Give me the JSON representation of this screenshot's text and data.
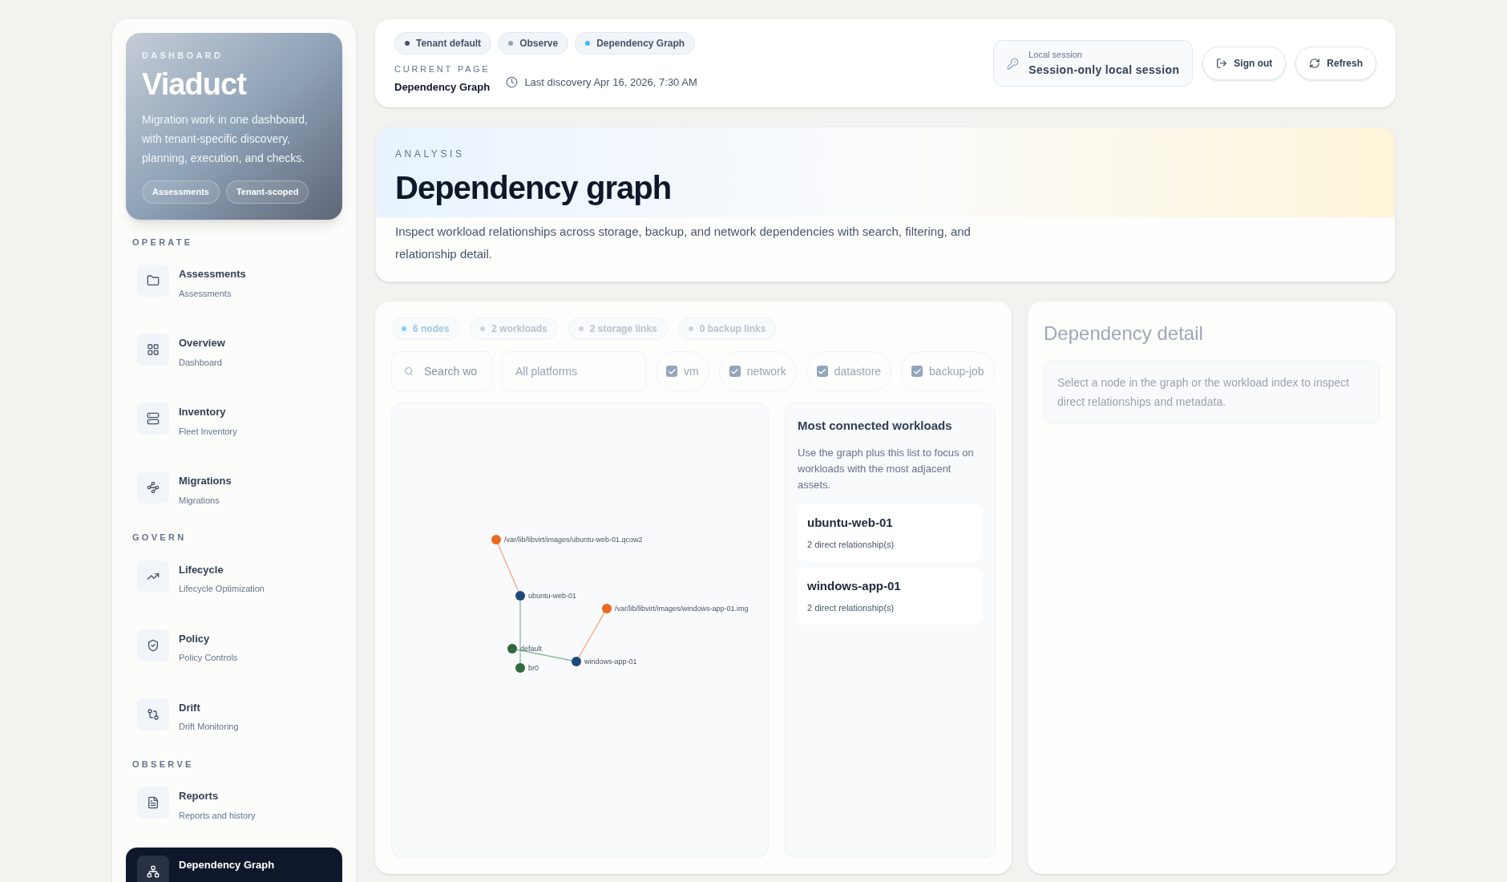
{
  "sidebar": {
    "hero": {
      "eyebrow": "DASHBOARD",
      "title": "Viaduct",
      "description": "Migration work in one dashboard, with tenant-specific discovery, planning, execution, and checks.",
      "tags": [
        "Assessments",
        "Tenant-scoped"
      ]
    },
    "sections": [
      {
        "label": "OPERATE",
        "items": [
          {
            "title": "Assessments",
            "subtitle": "Assessments",
            "selected": false
          },
          {
            "title": "Overview",
            "subtitle": "Dashboard",
            "selected": false
          },
          {
            "title": "Inventory",
            "subtitle": "Fleet Inventory",
            "selected": false
          },
          {
            "title": "Migrations",
            "subtitle": "Migrations",
            "selected": false
          }
        ]
      },
      {
        "label": "GOVERN",
        "items": [
          {
            "title": "Lifecycle",
            "subtitle": "Lifecycle Optimization",
            "selected": false
          },
          {
            "title": "Policy",
            "subtitle": "Policy Controls",
            "selected": false
          },
          {
            "title": "Drift",
            "subtitle": "Drift Monitoring",
            "selected": false
          }
        ]
      },
      {
        "label": "OBSERVE",
        "items": [
          {
            "title": "Reports",
            "subtitle": "Reports and history",
            "selected": false
          },
          {
            "title": "Dependency Graph",
            "selected": true
          }
        ]
      }
    ]
  },
  "header": {
    "breadcrumbs": [
      {
        "label": "Tenant default",
        "color": "#475569"
      },
      {
        "label": "Observe",
        "color": "#94a3b8"
      },
      {
        "label": "Dependency Graph",
        "color": "#38bdf8"
      }
    ],
    "current_page_label": "CURRENT PAGE",
    "current_page": "Dependency Graph",
    "last_discovery": "Last discovery Apr 16, 2026, 7:30 AM",
    "session": {
      "label": "Local session",
      "value": "Session-only local session"
    },
    "buttons": [
      {
        "kind": "signout",
        "label": "Sign out"
      },
      {
        "kind": "refresh",
        "label": "Refresh"
      }
    ]
  },
  "banner": {
    "eyebrow": "ANALYSIS",
    "title": "Dependency graph",
    "description": "Inspect workload relationships across storage, backup, and network dependencies with search, filtering, and relationship detail."
  },
  "stats": [
    {
      "label": "6 nodes",
      "color": "#7dd3fc"
    },
    {
      "label": "2 workloads",
      "color": "#cbd5e1"
    },
    {
      "label": "2 storage links",
      "color": "#cbd5e1"
    },
    {
      "label": "0 backup links",
      "color": "#cbd5e1"
    }
  ],
  "filters": {
    "search": {
      "placeholder": "Search wo"
    },
    "platform": "All platforms",
    "types": [
      {
        "label": "vm",
        "checked": true
      },
      {
        "label": "network",
        "checked": true
      },
      {
        "label": "datastore",
        "checked": true
      },
      {
        "label": "backup-job",
        "checked": true
      }
    ]
  },
  "graph": {
    "nodes": [
      {
        "label": "/var/lib/libvirt/images/ubuntu-web-01.qcow2",
        "kind": "storage"
      },
      {
        "label": "ubuntu-web-01",
        "kind": "workload"
      },
      {
        "label": "/var/lib/libvirt/images/windows-app-01.img",
        "kind": "storage"
      },
      {
        "label": "default",
        "kind": "network"
      },
      {
        "label": "br0",
        "kind": "network"
      },
      {
        "label": "windows-app-01",
        "kind": "workload"
      }
    ]
  },
  "connected": {
    "title": "Most connected workloads",
    "description": "Use the graph plus this list to focus on workloads with the most adjacent assets.",
    "items": [
      {
        "name": "ubuntu-web-01",
        "detail": "2 direct relationship(s)"
      },
      {
        "name": "windows-app-01",
        "detail": "2 direct relationship(s)"
      }
    ]
  },
  "detail": {
    "title": "Dependency detail",
    "hint": "Select a node in the graph or the workload index to inspect direct relationships and metadata."
  }
}
